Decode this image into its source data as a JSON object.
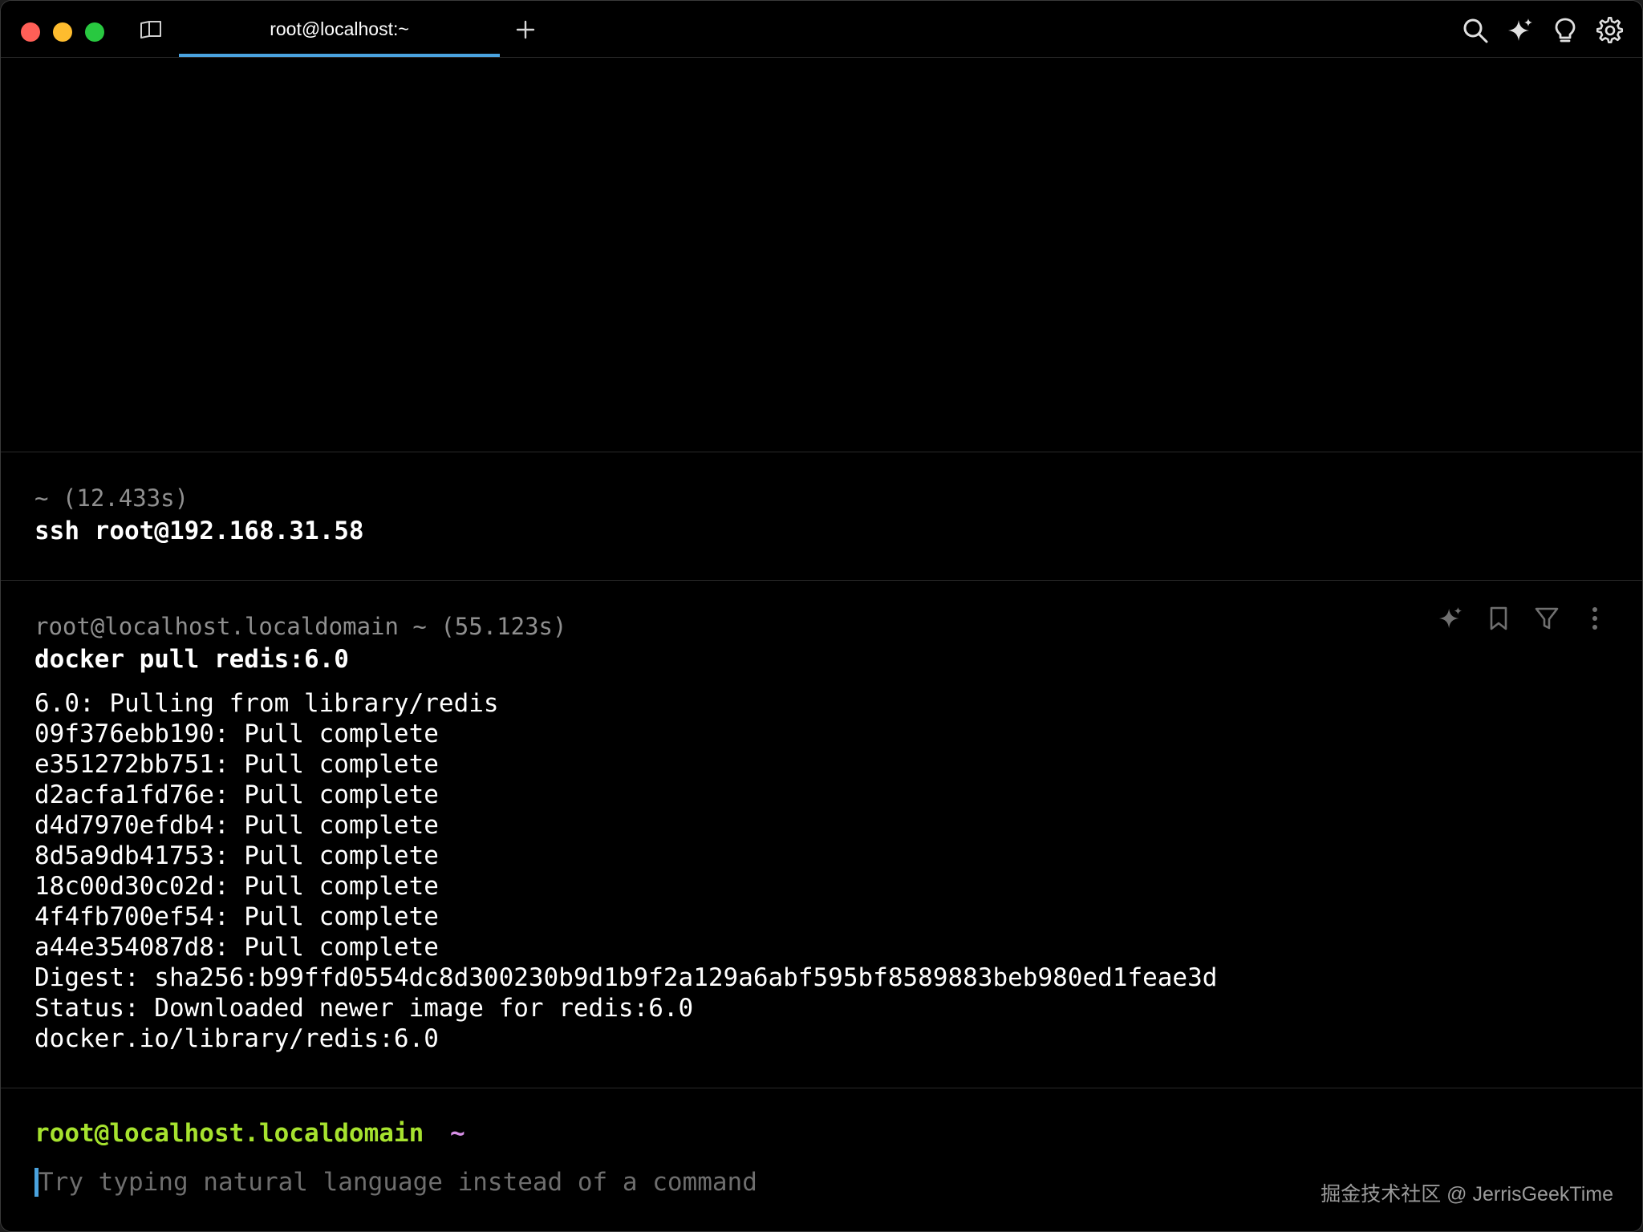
{
  "window": {
    "tab_title": "root@localhost:~",
    "new_tab_symbol": "+",
    "icons": [
      "split-view-icon",
      "search-icon",
      "ai-sparkle-icon",
      "lightbulb-icon",
      "gear-icon"
    ]
  },
  "blocks": [
    {
      "header": "~ (12.433s)",
      "command": "ssh root@192.168.31.58"
    },
    {
      "header": "root@localhost.localdomain ~ (55.123s)",
      "command": "docker pull redis:6.0",
      "output": [
        "6.0: Pulling from library/redis",
        "09f376ebb190: Pull complete",
        "e351272bb751: Pull complete",
        "d2acfa1fd76e: Pull complete",
        "d4d7970efdb4: Pull complete",
        "8d5a9db41753: Pull complete",
        "18c00d30c02d: Pull complete",
        "4f4fb700ef54: Pull complete",
        "a44e354087d8: Pull complete",
        "Digest: sha256:b99ffd0554dc8d300230b9d1b9f2a129a6abf595bf8589883beb980ed1feae3d",
        "Status: Downloaded newer image for redis:6.0",
        "docker.io/library/redis:6.0"
      ],
      "actions": [
        "ai-sparkle-icon",
        "bookmark-icon",
        "filter-icon",
        "more-vertical-icon"
      ]
    }
  ],
  "prompt": {
    "user_host": "root@localhost.localdomain",
    "path": "~"
  },
  "input": {
    "value": "",
    "placeholder": "Try typing natural language instead of a command"
  },
  "watermark": "掘金技术社区 @ JerrisGeekTime",
  "colors": {
    "background": "#000000",
    "accent": "#4aa3df",
    "prompt_user": "#a6e22e",
    "prompt_path": "#d78fe6",
    "muted": "#8f8f8f"
  }
}
